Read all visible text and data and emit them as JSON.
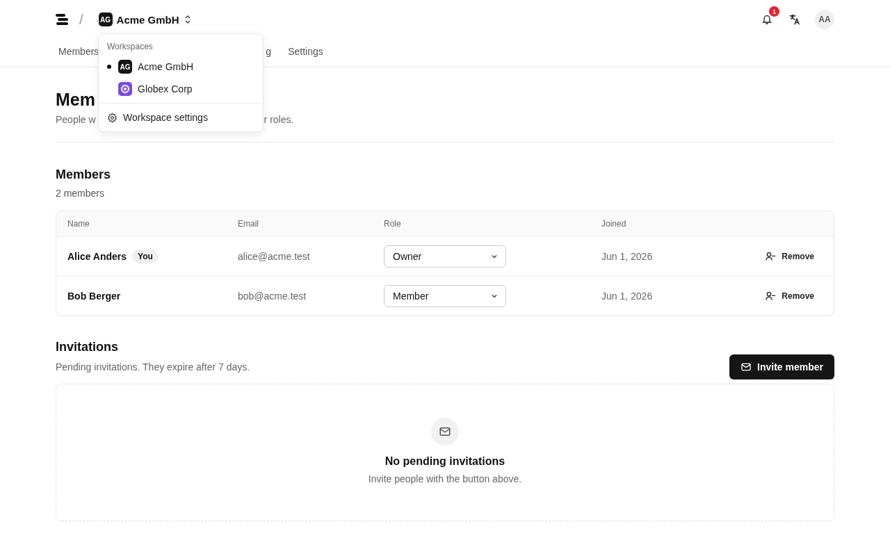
{
  "topbar": {
    "separator": "/",
    "workspace": {
      "initials": "AG",
      "name": "Acme GmbH"
    },
    "notifications": {
      "count": "1"
    },
    "avatar": "AA"
  },
  "tabs": [
    {
      "label": "Members"
    },
    {
      "label": "g"
    },
    {
      "label": "Settings"
    }
  ],
  "workspace_menu": {
    "heading": "Workspaces",
    "items": [
      {
        "kind": "initials",
        "initials": "AG",
        "name": "Acme GmbH",
        "selected": true
      },
      {
        "kind": "logo",
        "name": "Globex Corp",
        "selected": false
      }
    ],
    "settings": "Workspace settings"
  },
  "page": {
    "title": "Mem",
    "subtitle_parts": [
      "People w",
      "r roles."
    ]
  },
  "members": {
    "title": "Members",
    "count": "2 members",
    "columns": [
      "Name",
      "Email",
      "Role",
      "Joined"
    ],
    "rows": [
      {
        "name": "Alice Anders",
        "badge": "You",
        "email": "alice@acme.test",
        "role": "Owner",
        "joined": "Jun 1, 2026",
        "action": "Remove"
      },
      {
        "name": "Bob Berger",
        "email": "bob@acme.test",
        "role": "Member",
        "joined": "Jun 1, 2026",
        "action": "Remove"
      }
    ]
  },
  "invitations": {
    "title": "Invitations",
    "subtitle": "Pending invitations. They expire after 7 days.",
    "button": "Invite member",
    "empty_title": "No pending invitations",
    "empty_text": "Invite people with the button above."
  }
}
